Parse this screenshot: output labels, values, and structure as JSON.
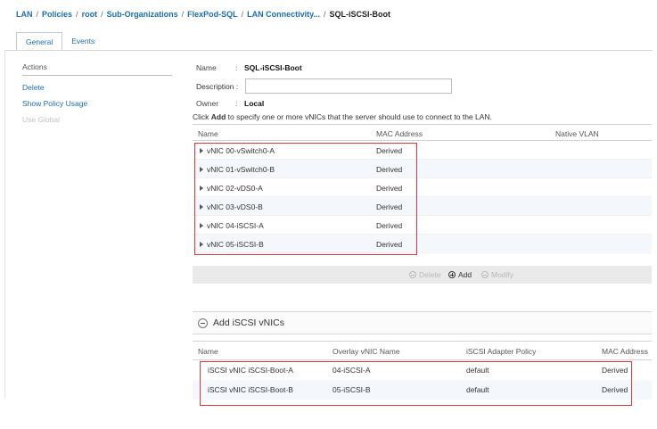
{
  "breadcrumb": {
    "items": [
      "LAN",
      "Policies",
      "root",
      "Sub-Organizations",
      "FlexPod-SQL",
      "LAN Connectivity..."
    ],
    "current": "SQL-iSCSI-Boot",
    "separator": "/"
  },
  "tabs": [
    {
      "label": "General",
      "active": true
    },
    {
      "label": "Events",
      "active": false
    }
  ],
  "actions": {
    "title": "Actions",
    "items": [
      "Delete",
      "Show Policy Usage",
      "Use Global"
    ]
  },
  "form": {
    "name_label": "Name",
    "name_value": "SQL-iSCSI-Boot",
    "description_label": "Description :",
    "description_value": "",
    "owner_label": "Owner",
    "owner_value": "Local",
    "colon": ":"
  },
  "hint": {
    "prefix": "Click ",
    "bold": "Add",
    "suffix": " to specify one or more vNICs that the server should use to connect to the LAN."
  },
  "vnic_table": {
    "columns": [
      "Name",
      "MAC Address",
      "Native VLAN"
    ],
    "rows": [
      {
        "name": "vNIC 00-vSwitch0-A",
        "mac": "Derived"
      },
      {
        "name": "vNIC 01-vSwitch0-B",
        "mac": "Derived"
      },
      {
        "name": "vNIC 02-vDS0-A",
        "mac": "Derived"
      },
      {
        "name": "vNIC 03-vDS0-B",
        "mac": "Derived"
      },
      {
        "name": "vNIC 04-iSCSI-A",
        "mac": "Derived"
      },
      {
        "name": "vNIC 05-iSCSI-B",
        "mac": "Derived"
      }
    ]
  },
  "toolbar": {
    "delete": "Delete",
    "add": "Add",
    "modify": "Modify"
  },
  "iscsi_section": {
    "title": "Add iSCSI vNICs",
    "columns": [
      "Name",
      "Overlay vNIC Name",
      "iSCSI Adapter Policy",
      "MAC Address"
    ],
    "rows": [
      {
        "name": "iSCSI vNIC iSCSI-Boot-A",
        "overlay": "04-iSCSI-A",
        "policy": "default",
        "mac": "Derived"
      },
      {
        "name": "iSCSI vNIC iSCSI-Boot-B",
        "overlay": "05-iSCSI-B",
        "policy": "default",
        "mac": "Derived"
      }
    ]
  },
  "colors": {
    "link": "#1a6fb5",
    "highlight_box": "#d9383a",
    "row_alt": "#f4f7fb"
  }
}
